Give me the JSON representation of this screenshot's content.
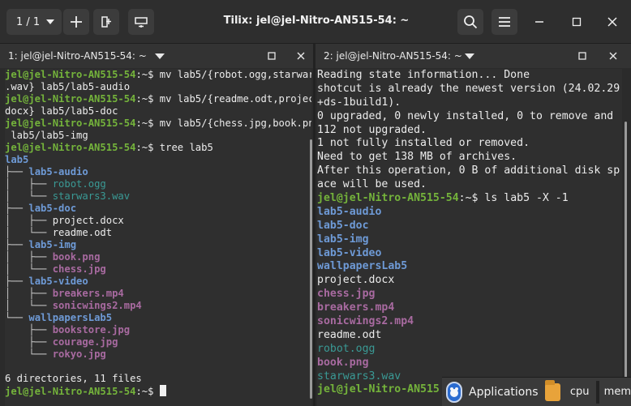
{
  "header": {
    "session_label": "1 / 1",
    "title": "Tilix: jel@jel-Nitro-AN515-54: ~"
  },
  "left_pane": {
    "tab_label": "1: jel@jel-Nitro-AN515-54: ~",
    "lines": [
      [
        {
          "c": "u",
          "t": "jel@jel-Nitro-AN515-54"
        },
        {
          "c": "p",
          "t": ":~$ mv lab5/{robot.ogg,starwars3"
        }
      ],
      [
        {
          "c": "p",
          "t": ".wav} lab5/lab5-audio"
        }
      ],
      [
        {
          "c": "u",
          "t": "jel@jel-Nitro-AN515-54"
        },
        {
          "c": "p",
          "t": ":~$ mv lab5/{readme.odt,project."
        }
      ],
      [
        {
          "c": "p",
          "t": "docx} lab5/lab5-doc"
        }
      ],
      [
        {
          "c": "u",
          "t": "jel@jel-Nitro-AN515-54"
        },
        {
          "c": "p",
          "t": ":~$ mv lab5/{chess.jpg,book.png}"
        }
      ],
      [
        {
          "c": "p",
          "t": " lab5/lab5-img"
        }
      ],
      [
        {
          "c": "u",
          "t": "jel@jel-Nitro-AN515-54"
        },
        {
          "c": "p",
          "t": ":~$ tree lab5"
        }
      ],
      [
        {
          "c": "d",
          "t": "lab5"
        }
      ],
      [
        {
          "c": "tree",
          "t": "├── "
        },
        {
          "c": "d",
          "t": "lab5-audio"
        }
      ],
      [
        {
          "c": "tree",
          "t": "│   ├── "
        },
        {
          "c": "a",
          "t": "robot.ogg"
        }
      ],
      [
        {
          "c": "tree",
          "t": "│   └── "
        },
        {
          "c": "a",
          "t": "starwars3.wav"
        }
      ],
      [
        {
          "c": "tree",
          "t": "├── "
        },
        {
          "c": "d",
          "t": "lab5-doc"
        }
      ],
      [
        {
          "c": "tree",
          "t": "│   ├── "
        },
        {
          "c": "p",
          "t": "project.docx"
        }
      ],
      [
        {
          "c": "tree",
          "t": "│   └── "
        },
        {
          "c": "p",
          "t": "readme.odt"
        }
      ],
      [
        {
          "c": "tree",
          "t": "├── "
        },
        {
          "c": "d",
          "t": "lab5-img"
        }
      ],
      [
        {
          "c": "tree",
          "t": "│   ├── "
        },
        {
          "c": "i",
          "t": "book.png"
        }
      ],
      [
        {
          "c": "tree",
          "t": "│   └── "
        },
        {
          "c": "i",
          "t": "chess.jpg"
        }
      ],
      [
        {
          "c": "tree",
          "t": "├── "
        },
        {
          "c": "d",
          "t": "lab5-video"
        }
      ],
      [
        {
          "c": "tree",
          "t": "│   ├── "
        },
        {
          "c": "i",
          "t": "breakers.mp4"
        }
      ],
      [
        {
          "c": "tree",
          "t": "│   └── "
        },
        {
          "c": "i",
          "t": "sonicwings2.mp4"
        }
      ],
      [
        {
          "c": "tree",
          "t": "└── "
        },
        {
          "c": "d",
          "t": "wallpapersLab5"
        }
      ],
      [
        {
          "c": "tree",
          "t": "    ├── "
        },
        {
          "c": "i",
          "t": "bookstore.jpg"
        }
      ],
      [
        {
          "c": "tree",
          "t": "    ├── "
        },
        {
          "c": "i",
          "t": "courage.jpg"
        }
      ],
      [
        {
          "c": "tree",
          "t": "    └── "
        },
        {
          "c": "i",
          "t": "rokyo.jpg"
        }
      ],
      [
        {
          "c": "p",
          "t": ""
        }
      ],
      [
        {
          "c": "p",
          "t": "6 directories, 11 files"
        }
      ],
      [
        {
          "c": "u",
          "t": "jel@jel-Nitro-AN515-54"
        },
        {
          "c": "p",
          "t": ":~$ "
        },
        {
          "c": "cursor",
          "t": ""
        }
      ]
    ]
  },
  "right_pane": {
    "tab_label": "2: jel@jel-Nitro-AN515-54: ~",
    "lines": [
      [
        {
          "c": "p",
          "t": "Reading state information... Done"
        }
      ],
      [
        {
          "c": "p",
          "t": "shotcut is already the newest version (24.02.29"
        }
      ],
      [
        {
          "c": "p",
          "t": "+ds-1build1)."
        }
      ],
      [
        {
          "c": "p",
          "t": "0 upgraded, 0 newly installed, 0 to remove and"
        }
      ],
      [
        {
          "c": "p",
          "t": "112 not upgraded."
        }
      ],
      [
        {
          "c": "p",
          "t": "1 not fully installed or removed."
        }
      ],
      [
        {
          "c": "p",
          "t": "Need to get 138 MB of archives."
        }
      ],
      [
        {
          "c": "p",
          "t": "After this operation, 0 B of additional disk sp"
        }
      ],
      [
        {
          "c": "p",
          "t": "ace will be used."
        }
      ],
      [
        {
          "c": "u",
          "t": "jel@jel-Nitro-AN515-54"
        },
        {
          "c": "p",
          "t": ":~$ ls lab5 -X -1"
        }
      ],
      [
        {
          "c": "d",
          "t": "lab5-audio"
        }
      ],
      [
        {
          "c": "d",
          "t": "lab5-doc"
        }
      ],
      [
        {
          "c": "d",
          "t": "lab5-img"
        }
      ],
      [
        {
          "c": "d",
          "t": "lab5-video"
        }
      ],
      [
        {
          "c": "d",
          "t": "wallpapersLab5"
        }
      ],
      [
        {
          "c": "p",
          "t": "project.docx"
        }
      ],
      [
        {
          "c": "i",
          "t": "chess.jpg"
        }
      ],
      [
        {
          "c": "i",
          "t": "breakers.mp4"
        }
      ],
      [
        {
          "c": "i",
          "t": "sonicwings2.mp4"
        }
      ],
      [
        {
          "c": "p",
          "t": "readme.odt"
        }
      ],
      [
        {
          "c": "a",
          "t": "robot.ogg"
        }
      ],
      [
        {
          "c": "i",
          "t": "book.png"
        }
      ],
      [
        {
          "c": "a",
          "t": "starwars3.wav"
        }
      ],
      [
        {
          "c": "u",
          "t": "jel@jel-Nitro-AN515"
        }
      ]
    ]
  },
  "taskbar": {
    "applications_label": "Applications",
    "cpu_label": "cpu",
    "mem_label": "mem"
  },
  "colors": {
    "prompt_user": "#74b33b",
    "directory": "#6e9ad6",
    "image_video": "#a86aa0",
    "audio": "#3a9a95",
    "terminal_bg": "#2f2f2f"
  }
}
